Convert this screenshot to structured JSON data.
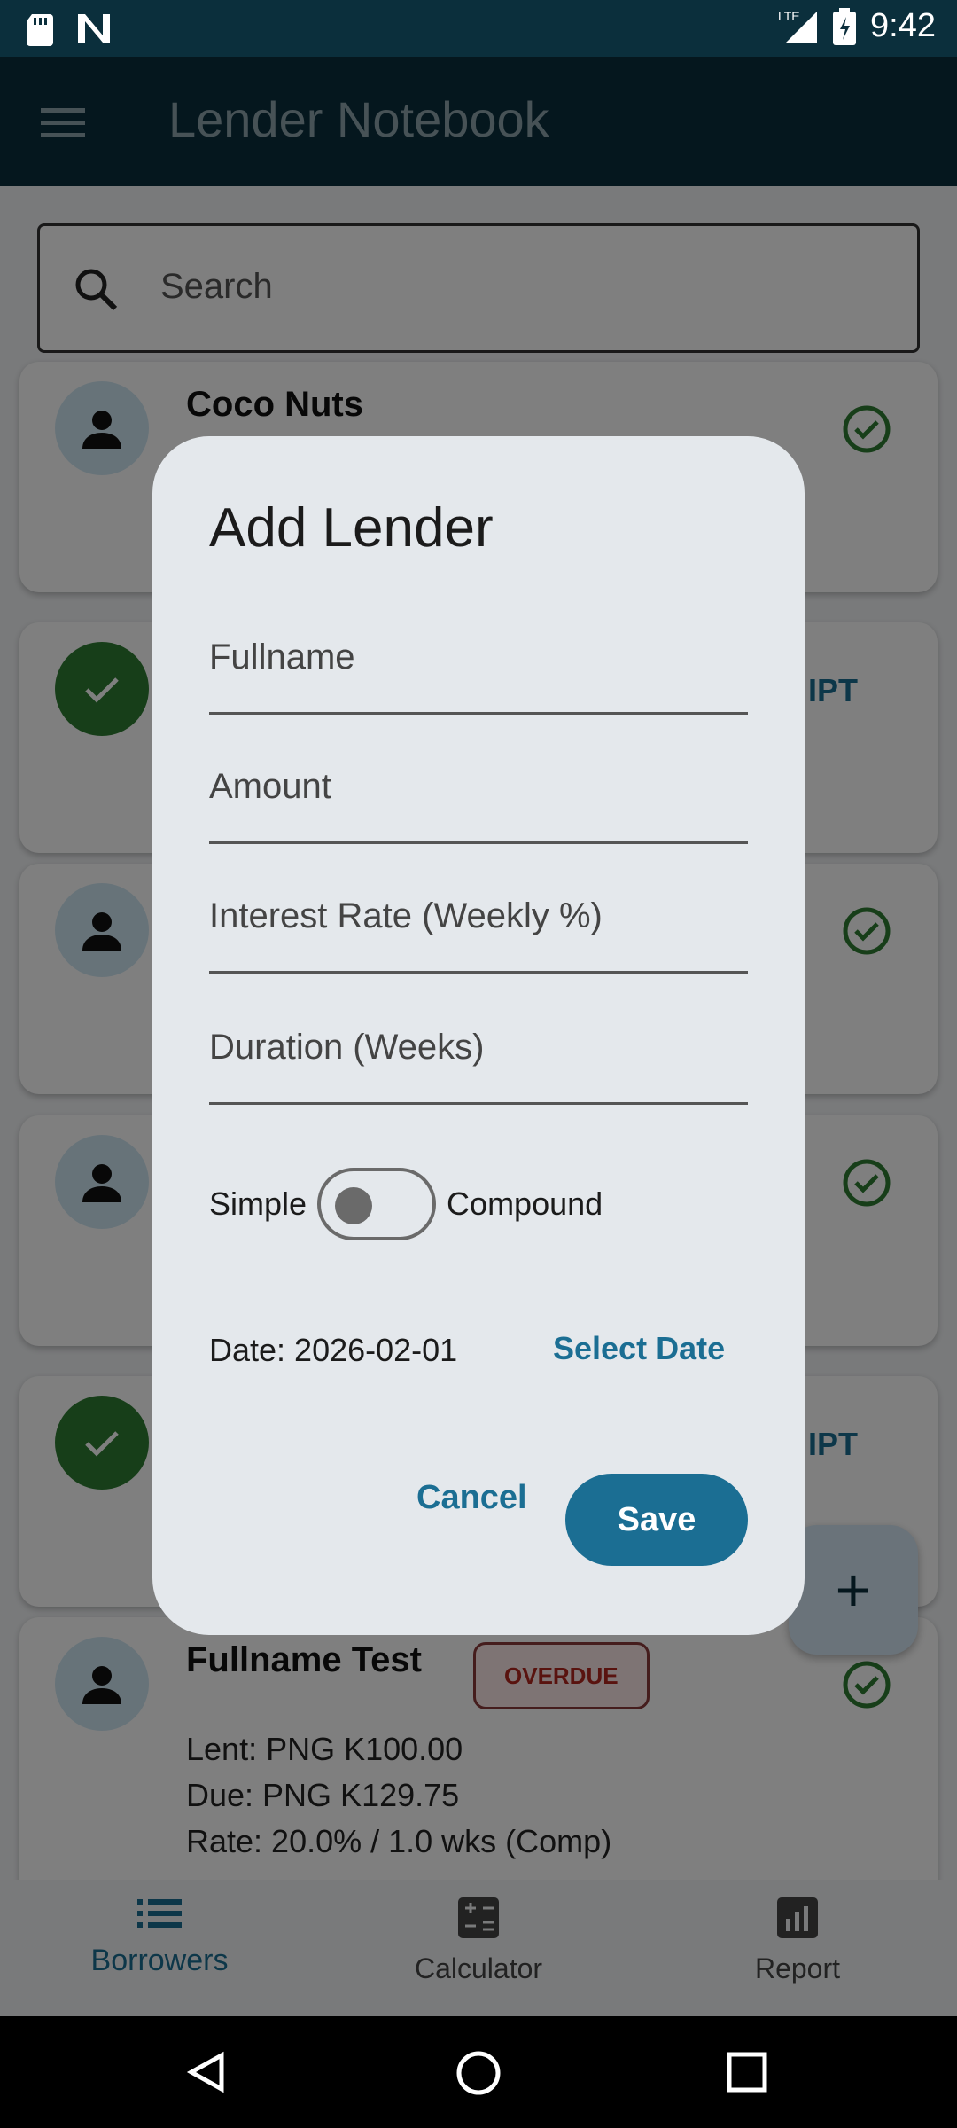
{
  "status_bar": {
    "time": "9:42",
    "network": "LTE"
  },
  "app_bar": {
    "title": "Lender Notebook"
  },
  "search": {
    "placeholder": "Search"
  },
  "cards": [
    {
      "name": "Coco Nuts",
      "status": "active"
    },
    {
      "action": "RECEIPT",
      "status": "paid"
    },
    {
      "status": "active"
    },
    {
      "status": "active"
    },
    {
      "action": "RECEIPT",
      "status": "paid"
    },
    {
      "name": "Fullname Test",
      "badge": "OVERDUE",
      "lent": "Lent: PNG K100.00",
      "due": "Due: PNG K129.75",
      "rate": "Rate: 20.0% / 1.0 wks (Comp)",
      "status": "active"
    }
  ],
  "receipt_partial": "IPT",
  "fab": {
    "label": "+"
  },
  "bottom_nav": {
    "items": [
      {
        "label": "Borrowers",
        "active": true
      },
      {
        "label": "Calculator",
        "active": false
      },
      {
        "label": "Report",
        "active": false
      }
    ]
  },
  "dialog": {
    "title": "Add Lender",
    "fields": {
      "fullname": "Fullname",
      "amount": "Amount",
      "interest_rate": "Interest Rate (Weekly %)",
      "duration": "Duration (Weeks)"
    },
    "toggle": {
      "left_label": "Simple",
      "right_label": "Compound",
      "on": false
    },
    "date_text": "Date: 2026-02-01",
    "select_date_label": "Select Date",
    "cancel_label": "Cancel",
    "save_label": "Save"
  },
  "colors": {
    "primary": "#0b2f3c",
    "accent": "#1b6e93",
    "success": "#2e7d32",
    "danger": "#b3261e"
  }
}
